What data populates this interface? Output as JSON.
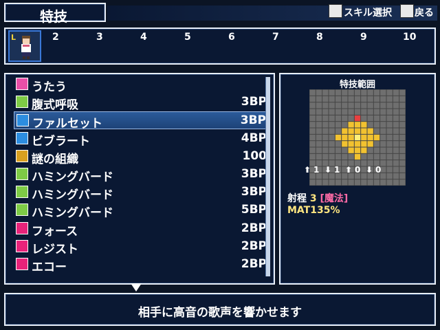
{
  "header": {
    "title": "特技",
    "hint_skill": "スキル選択",
    "hint_back": "戻る",
    "hint_skill_icon": "dpad-icon",
    "hint_back_icon": "x-button-icon"
  },
  "party": {
    "active_label": "L",
    "slots": [
      "2",
      "3",
      "4",
      "5",
      "6",
      "7",
      "8",
      "9",
      "10"
    ]
  },
  "skills": [
    {
      "name": "うたう",
      "cost": "",
      "icon_color": "#e84fa8"
    },
    {
      "name": "腹式呼吸",
      "cost": "3BP",
      "icon_color": "#7ecb46"
    },
    {
      "name": "ファルセット",
      "cost": "3BP",
      "icon_color": "#2c8de0",
      "selected": true
    },
    {
      "name": "ビブラート",
      "cost": "4BP",
      "icon_color": "#2c8de0"
    },
    {
      "name": "謎の組織",
      "cost": "100",
      "icon_color": "#d8a020"
    },
    {
      "name": "ハミングバード",
      "cost": "3BP",
      "icon_color": "#7ecb46"
    },
    {
      "name": "ハミングバード",
      "cost": "3BP",
      "icon_color": "#7ecb46"
    },
    {
      "name": "ハミングバード",
      "cost": "5BP",
      "icon_color": "#7ecb46"
    },
    {
      "name": "フォース",
      "cost": "2BP",
      "icon_color": "#e8237a"
    },
    {
      "name": "レジスト",
      "cost": "2BP",
      "icon_color": "#e8237a"
    },
    {
      "name": "エコー",
      "cost": "2BP",
      "icon_color": "#e8237a"
    }
  ],
  "range_panel": {
    "title": "特技範囲",
    "stats": [
      "1",
      "1",
      "0",
      "0"
    ],
    "range_label": "射程",
    "range_value": "3",
    "range_type": "[魔法]",
    "mat": "MAT135%"
  },
  "description": "相手に高音の歌声を響かせます"
}
